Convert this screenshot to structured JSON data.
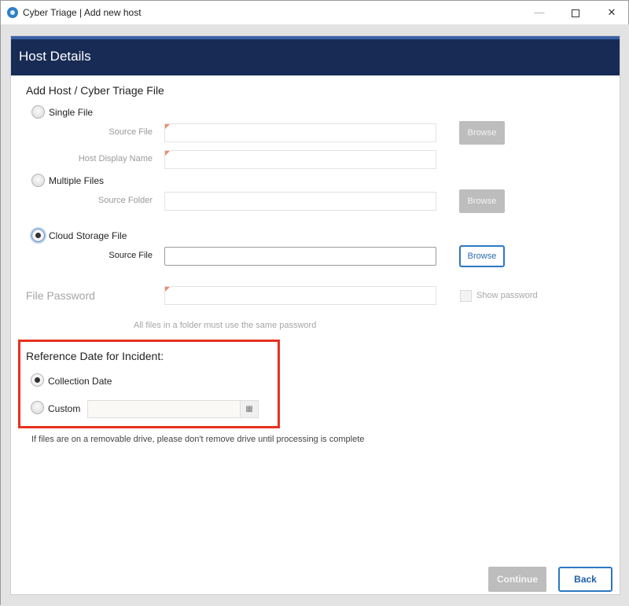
{
  "window": {
    "title": "Cyber Triage | Add new host",
    "app_icon": "cyber-triage-icon",
    "controls": {
      "minimize": "—",
      "maximize": "",
      "close": "✕"
    }
  },
  "panel": {
    "header": "Host Details"
  },
  "add_host": {
    "section_title": "Add Host / Cyber Triage File",
    "single_file": {
      "label": "Single File",
      "selected": false,
      "source_file_label": "Source File",
      "source_file_value": "",
      "browse_label": "Browse",
      "host_display_name_label": "Host Display Name",
      "host_display_name_value": ""
    },
    "multiple_files": {
      "label": "Multiple Files",
      "selected": false,
      "source_folder_label": "Source Folder",
      "source_folder_value": "",
      "browse_label": "Browse"
    },
    "cloud_storage_file": {
      "label": "Cloud Storage File",
      "selected": true,
      "source_file_label": "Source File",
      "source_file_value": "",
      "browse_label": "Browse"
    },
    "file_password": {
      "label": "File Password",
      "value": "",
      "show_password_label": "Show password",
      "show_password_checked": false,
      "hint": "All files in a folder must use the same password"
    }
  },
  "reference_date": {
    "title": "Reference Date for Incident:",
    "collection_date_label": "Collection Date",
    "collection_date_selected": true,
    "custom_label": "Custom",
    "custom_selected": false,
    "custom_value": "",
    "calendar_icon": "calendar-icon",
    "calendar_glyph": "▦"
  },
  "note": "If files are on a removable drive, please don't remove drive until processing is complete",
  "footer": {
    "continue_label": "Continue",
    "back_label": "Back"
  },
  "colors": {
    "header_bg": "#182b55",
    "header_accent": "#3a63a8",
    "highlight": "#e8311f",
    "primary_blue": "#2b78c2",
    "disabled_gray": "#bdbdbd"
  }
}
